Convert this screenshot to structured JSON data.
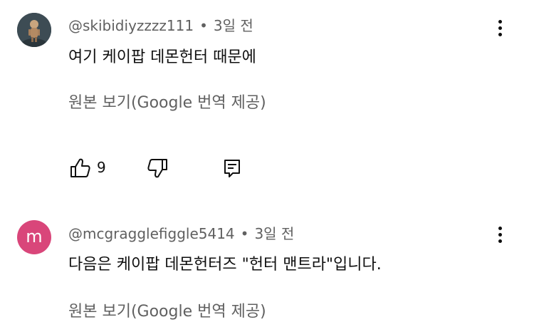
{
  "comments": [
    {
      "author": "@skibidiyzzzz111",
      "time": "3일 전",
      "text": "여기 케이팝 데몬헌터 때문에",
      "translate_label": "원본 보기(Google 번역 제공)",
      "likes": "9",
      "icons": [
        "thumbs-up-icon",
        "thumbs-down-icon",
        "reply-icon",
        "more-vert-icon"
      ]
    },
    {
      "author": "@mcgragglefiggle5414",
      "avatar_letter": "m",
      "avatar_color": "#d9467a",
      "time": "3일 전",
      "text": "다음은 케이팝 데몬헌터즈 \"헌터 맨트라\"입니다.",
      "translate_label": "원본 보기(Google 번역 제공)"
    }
  ],
  "separator": "•"
}
